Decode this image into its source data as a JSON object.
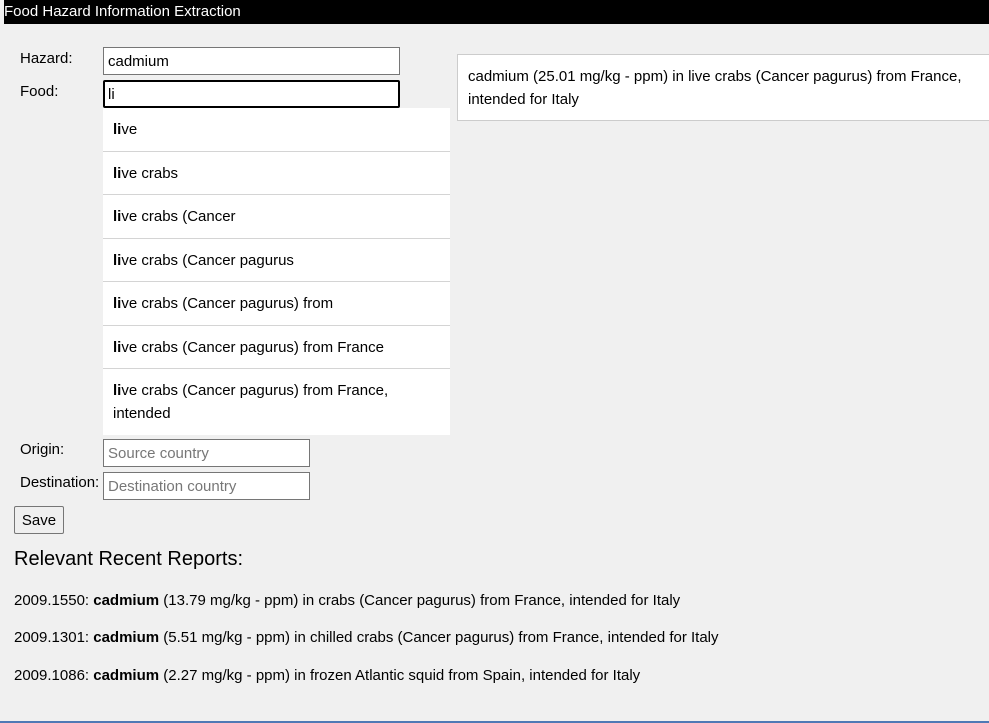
{
  "app": {
    "title": "Food Hazard Information Extraction"
  },
  "form": {
    "hazard_label": "Hazard:",
    "hazard_value": "cadmium",
    "food_label": "Food:",
    "food_value": "li",
    "origin_label": "Origin:",
    "origin_placeholder": "Source country",
    "destination_label": "Destination:",
    "destination_placeholder": "Destination country",
    "save_label": "Save"
  },
  "autocomplete": {
    "match": "li",
    "items": [
      {
        "rest": "ve"
      },
      {
        "rest": "ve crabs"
      },
      {
        "rest": "ve crabs (Cancer"
      },
      {
        "rest": "ve crabs (Cancer pagurus"
      },
      {
        "rest": "ve crabs (Cancer pagurus) from"
      },
      {
        "rest": "ve crabs (Cancer pagurus) from France"
      },
      {
        "rest": "ve crabs (Cancer pagurus) from France, intended"
      }
    ]
  },
  "preview": {
    "text": "cadmium (25.01 mg/kg - ppm) in live crabs (Cancer pagurus) from France, intended for Italy"
  },
  "reports": {
    "title": "Relevant Recent Reports:",
    "items": [
      {
        "id": "2009.1550:",
        "hazard": "cadmium",
        "rest": "(13.79 mg/kg - ppm) in crabs (Cancer pagurus) from France, intended for Italy"
      },
      {
        "id": "2009.1301:",
        "hazard": "cadmium",
        "rest": "(5.51 mg/kg - ppm) in chilled crabs (Cancer pagurus) from France, intended for Italy"
      },
      {
        "id": "2009.1086:",
        "hazard": "cadmium",
        "rest": "(2.27 mg/kg - ppm) in frozen Atlantic squid from Spain, intended for Italy"
      }
    ]
  }
}
